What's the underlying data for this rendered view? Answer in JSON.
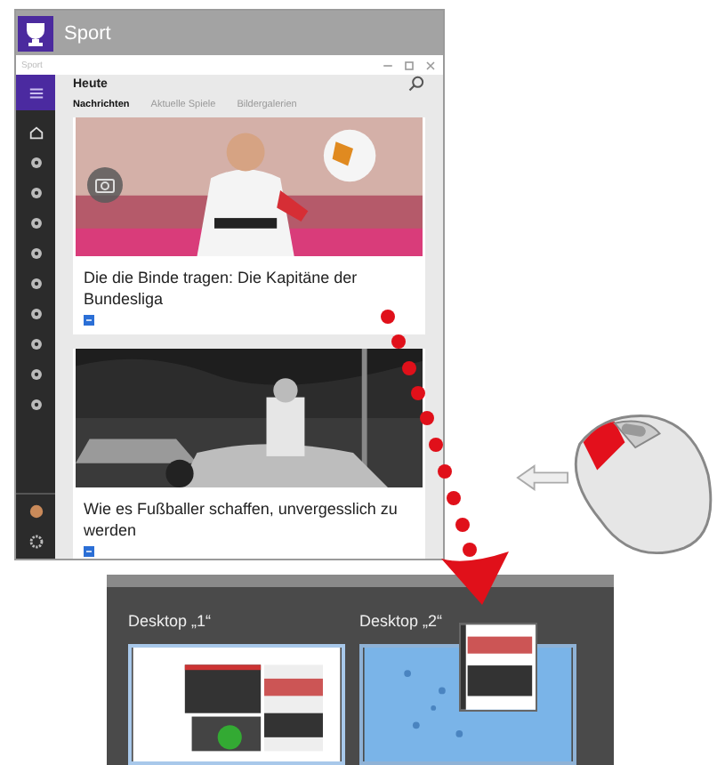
{
  "app": {
    "title": "Sport",
    "window_title": "Sport",
    "header": "Heute",
    "tabs": [
      {
        "label": "Nachrichten",
        "selected": true
      },
      {
        "label": "Aktuelle Spiele",
        "selected": false
      },
      {
        "label": "Bildergalerien",
        "selected": false
      }
    ],
    "articles": [
      {
        "headline": "Die die Binde tragen: Die Kapitäne der Bundesliga",
        "kind": "picture"
      },
      {
        "headline": "Wie es Fußballer schaffen, unvergesslich zu werden",
        "kind": "picture"
      }
    ]
  },
  "task_view": {
    "desktops": [
      {
        "label": "Desktop „1“",
        "kind": "full"
      },
      {
        "label": "Desktop „2“",
        "kind": "drop"
      }
    ]
  }
}
